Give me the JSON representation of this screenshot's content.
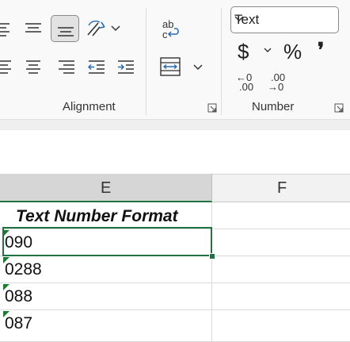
{
  "ribbon": {
    "alignment": {
      "label": "Alignment",
      "icons": [
        "align-left-top-icon",
        "align-center-top-icon",
        "align-bottom-icon",
        "orientation-icon",
        "chevron-down-icon",
        "wrap-text-icon",
        "align-left-icon",
        "align-center-icon",
        "align-right-icon",
        "decrease-indent-icon",
        "increase-indent-icon",
        "merge-center-icon",
        "dialog-launcher-icon"
      ]
    },
    "number": {
      "label": "Number",
      "format_value": "Text",
      "currency_symbol": "$",
      "percent_symbol": "%",
      "comma_symbol": "❜",
      "increase_decimal": {
        "top": "←0",
        "bottom": ".00"
      },
      "decrease_decimal": {
        "top": ".00",
        "bottom": "→0"
      }
    }
  },
  "grid": {
    "columns": [
      "E",
      "F"
    ],
    "header_cell": "Text Number Format",
    "rows": [
      "090",
      "0288",
      "088",
      "087"
    ],
    "accent": "#217346",
    "error_marker_color": "#1e7b34"
  }
}
